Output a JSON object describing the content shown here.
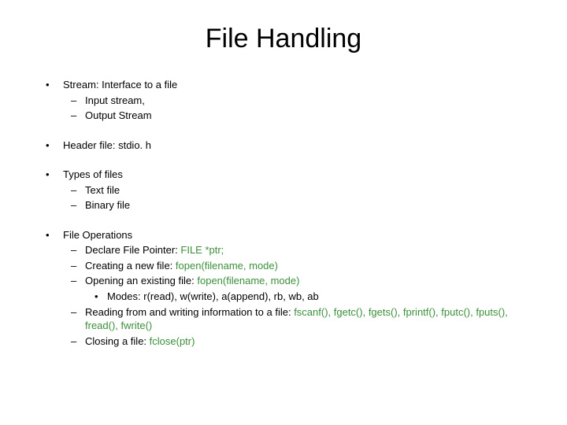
{
  "title": "File Handling",
  "b1": {
    "head": "Stream: Interface to a file",
    "s1": "Input stream,",
    "s2": "Output Stream"
  },
  "b2": "Header file: stdio. h",
  "b3": {
    "head": "Types of files",
    "s1": "Text file",
    "s2": "Binary file"
  },
  "b4": {
    "head": "File Operations",
    "s1": {
      "t1": "Declare File Pointer: ",
      "g": "FILE *ptr;"
    },
    "s2": {
      "t1": "Creating a new file: ",
      "g": "fopen(filename, mode)"
    },
    "s3": {
      "t1": "Opening an existing file: ",
      "g": "fopen(filename, mode)",
      "modes": "Modes: r(read), w(write), a(append), rb, wb, ab"
    },
    "s4": {
      "t1": "Reading from and writing information to a file: ",
      "g": "fscanf(), fgetc(), fgets(), fprintf(), fputc(), fputs(), fread(), fwrite()"
    },
    "s5": {
      "t1": "Closing a file: ",
      "g": "fclose(ptr)"
    }
  }
}
